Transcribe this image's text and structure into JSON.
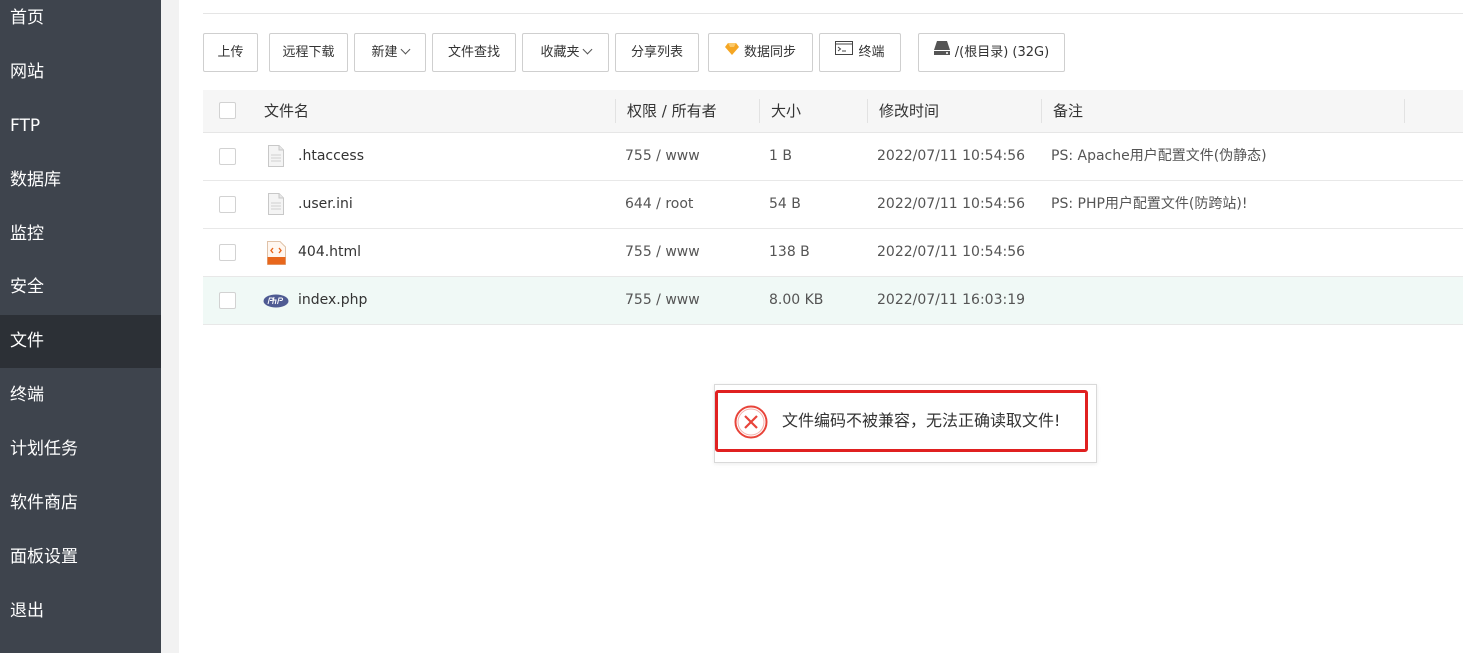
{
  "sidebar": {
    "items": [
      {
        "label": "首页"
      },
      {
        "label": "网站"
      },
      {
        "label": "FTP"
      },
      {
        "label": "数据库"
      },
      {
        "label": "监控"
      },
      {
        "label": "安全"
      },
      {
        "label": "文件",
        "active": true
      },
      {
        "label": "终端"
      },
      {
        "label": "计划任务"
      },
      {
        "label": "软件商店"
      },
      {
        "label": "面板设置"
      },
      {
        "label": "退出"
      }
    ]
  },
  "toolbar": {
    "upload": "上传",
    "remote_download": "远程下载",
    "new": "新建",
    "file_search": "文件查找",
    "favorites": "收藏夹",
    "share_list": "分享列表",
    "data_sync": "数据同步",
    "terminal": "终端",
    "disk": "/(根目录) (32G)"
  },
  "table": {
    "headers": {
      "name": "文件名",
      "perm": "权限 / 所有者",
      "size": "大小",
      "mtime": "修改时间",
      "note": "备注"
    },
    "rows": [
      {
        "name": ".htaccess",
        "perm": "755 / www",
        "size": "1 B",
        "mtime": "2022/07/11 10:54:56",
        "note": "PS: Apache用户配置文件(伪静态)",
        "icon": "text-file-icon"
      },
      {
        "name": ".user.ini",
        "perm": "644 / root",
        "size": "54 B",
        "mtime": "2022/07/11 10:54:56",
        "note": "PS: PHP用户配置文件(防跨站)!",
        "icon": "text-file-icon"
      },
      {
        "name": "404.html",
        "perm": "755 / www",
        "size": "138 B",
        "mtime": "2022/07/11 10:54:56",
        "note": "",
        "icon": "html-file-icon"
      },
      {
        "name": "index.php",
        "perm": "755 / www",
        "size": "8.00 KB",
        "mtime": "2022/07/11 16:03:19",
        "note": "",
        "icon": "php-file-icon",
        "highlighted": true
      }
    ]
  },
  "dialog": {
    "message": "文件编码不被兼容，无法正确读取文件!",
    "icon": "error-circle-icon",
    "accent": "#e02020"
  },
  "colors": {
    "sidebar_bg": "#3e444d",
    "sidebar_active": "#2c3036",
    "row_highlight": "#f0f9f6",
    "diamond": "#f5a623"
  }
}
